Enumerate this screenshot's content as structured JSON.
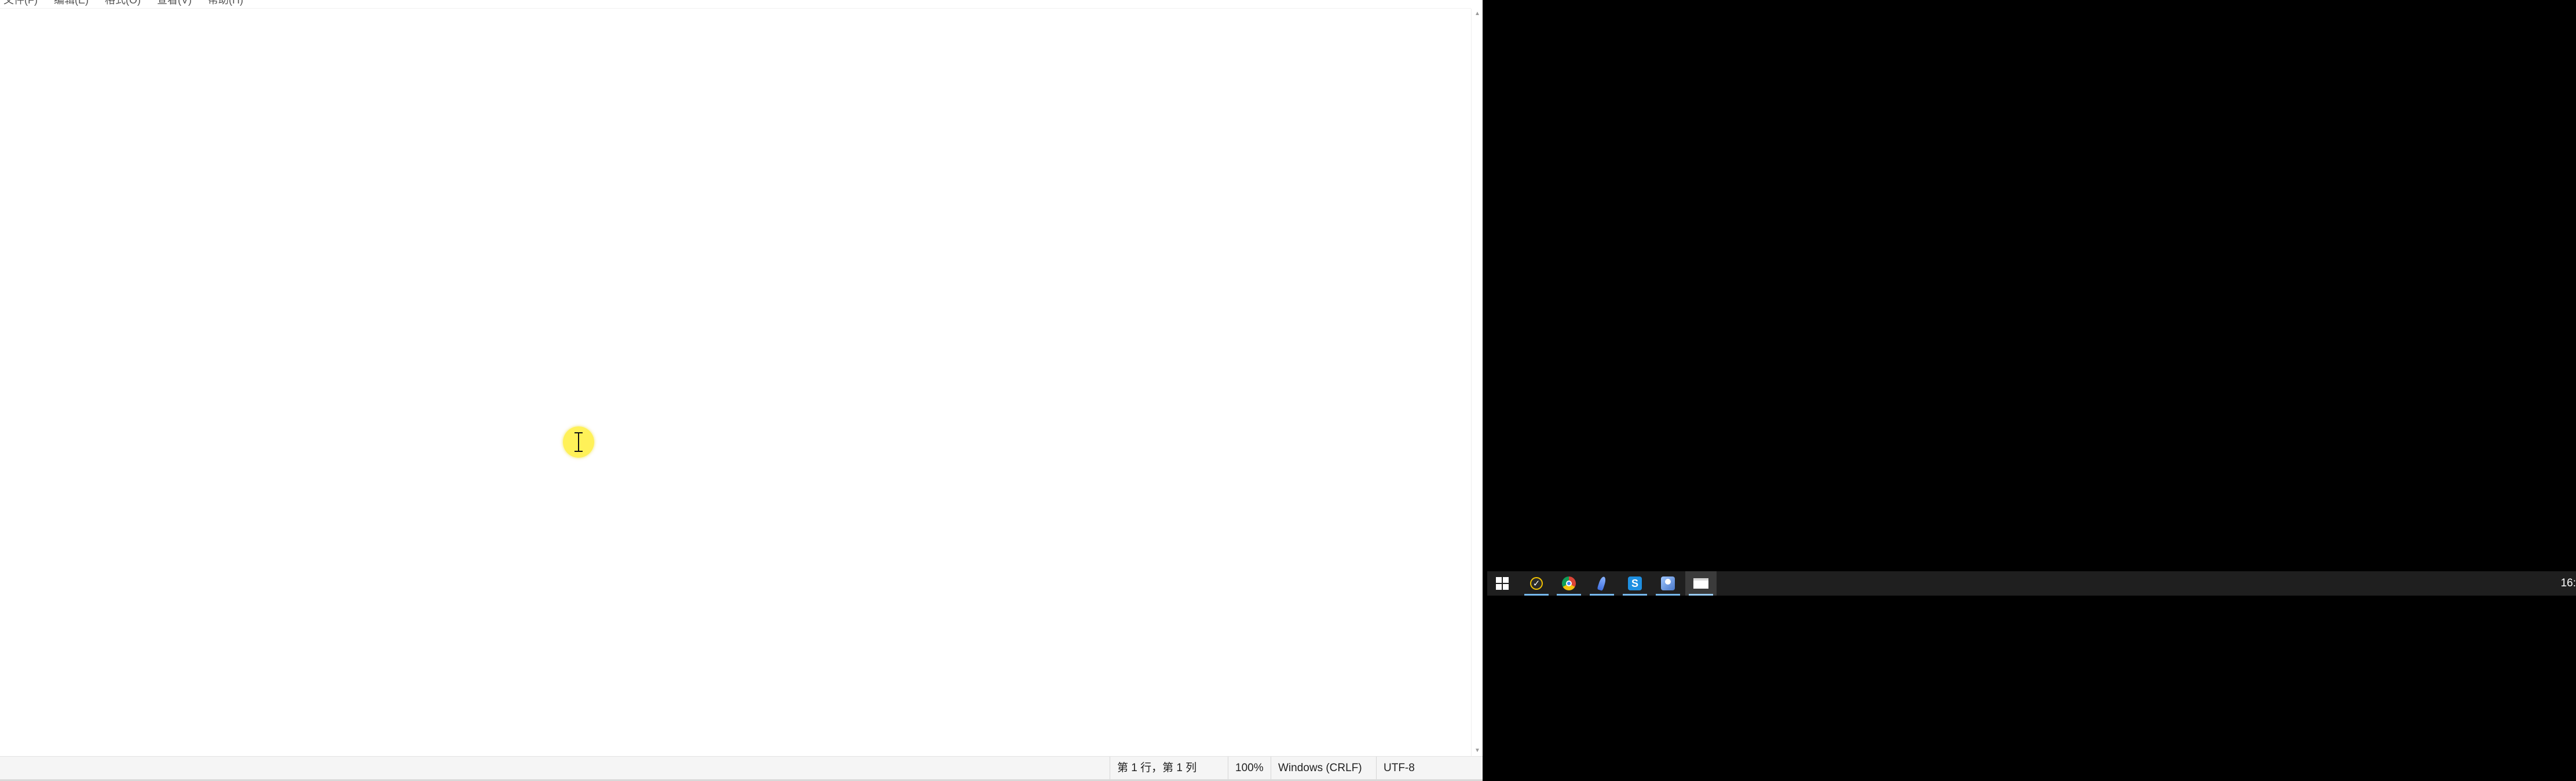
{
  "menubar": {
    "items": [
      "文件(F)",
      "编辑(E)",
      "格式(O)",
      "查看(V)",
      "帮助(H)"
    ]
  },
  "editor": {
    "content": ""
  },
  "statusbar": {
    "position": "第 1 行，第 1 列",
    "zoom": "100%",
    "line_ending": "Windows (CRLF)",
    "encoding": "UTF-8"
  },
  "scrollbar": {
    "up_arrow": "▲",
    "down_arrow": "▼"
  },
  "taskbar": {
    "start_icon": "windows-logo-icon",
    "apps": [
      {
        "icon": "checkmark-app-icon",
        "open": true
      },
      {
        "icon": "chrome-icon",
        "open": true
      },
      {
        "icon": "feather-app-icon",
        "open": true
      },
      {
        "icon": "lightning-app-icon",
        "glyph": "S",
        "open": true
      },
      {
        "icon": "people-app-icon",
        "open": true
      },
      {
        "icon": "notepad-icon",
        "open": true,
        "active": true
      }
    ],
    "clock": "16:"
  },
  "colors": {
    "taskbar_bg": "#1f1f1f",
    "indicator": "#76b9ed",
    "cursor_highlight": "#fff046"
  }
}
